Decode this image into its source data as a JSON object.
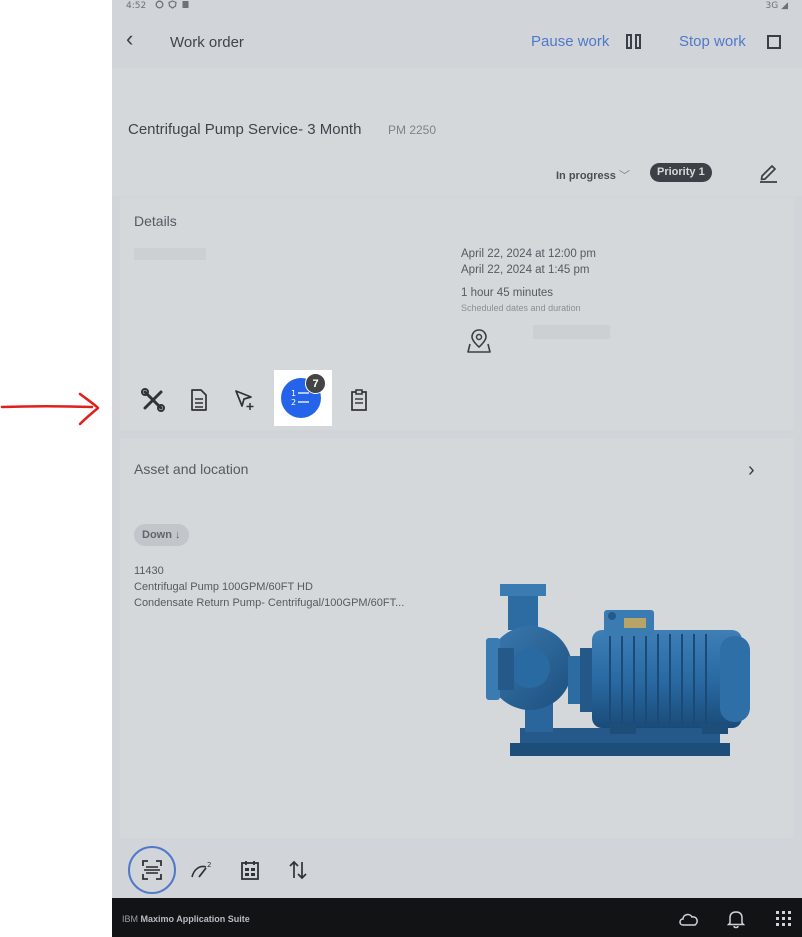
{
  "status_bar": {
    "time": "4:52",
    "network": "3G"
  },
  "header": {
    "title": "Work order",
    "pause_label": "Pause work",
    "stop_label": "Stop work"
  },
  "work_order": {
    "title": "Centrifugal Pump Service- 3 Month",
    "id": "PM 2250",
    "status": "In progress",
    "priority": "Priority 1"
  },
  "details": {
    "heading": "Details",
    "start": "April 22, 2024  at  12:00 pm",
    "end": "April 22, 2024  at  1:45 pm",
    "duration": "1 hour 45 minutes",
    "duration_caption": "Scheduled dates and duration"
  },
  "toolbar": {
    "items": [
      "tools-icon",
      "document-icon",
      "cursor-select-icon",
      "task-list-icon",
      "clipboard-icon"
    ],
    "tasks_count": "7"
  },
  "asset": {
    "heading": "Asset and location",
    "status": "Down ↓",
    "number": "11430",
    "description": "Centrifugal Pump 100GPM/60FT HD",
    "subdescription": "Condensate Return Pump- Centrifugal/100GPM/60FT..."
  },
  "bottom_toolbar": {
    "items": [
      "scan-icon",
      "meter-icon",
      "calendar-icon",
      "sort-icon"
    ]
  },
  "footer": {
    "brand_prefix": "IBM",
    "brand_name": "Maximo Application Suite"
  },
  "colors": {
    "accent_blue": "#2463ea",
    "link_blue": "#5079c8",
    "annotation_red": "#e0201c",
    "footer_bg": "#121315"
  }
}
